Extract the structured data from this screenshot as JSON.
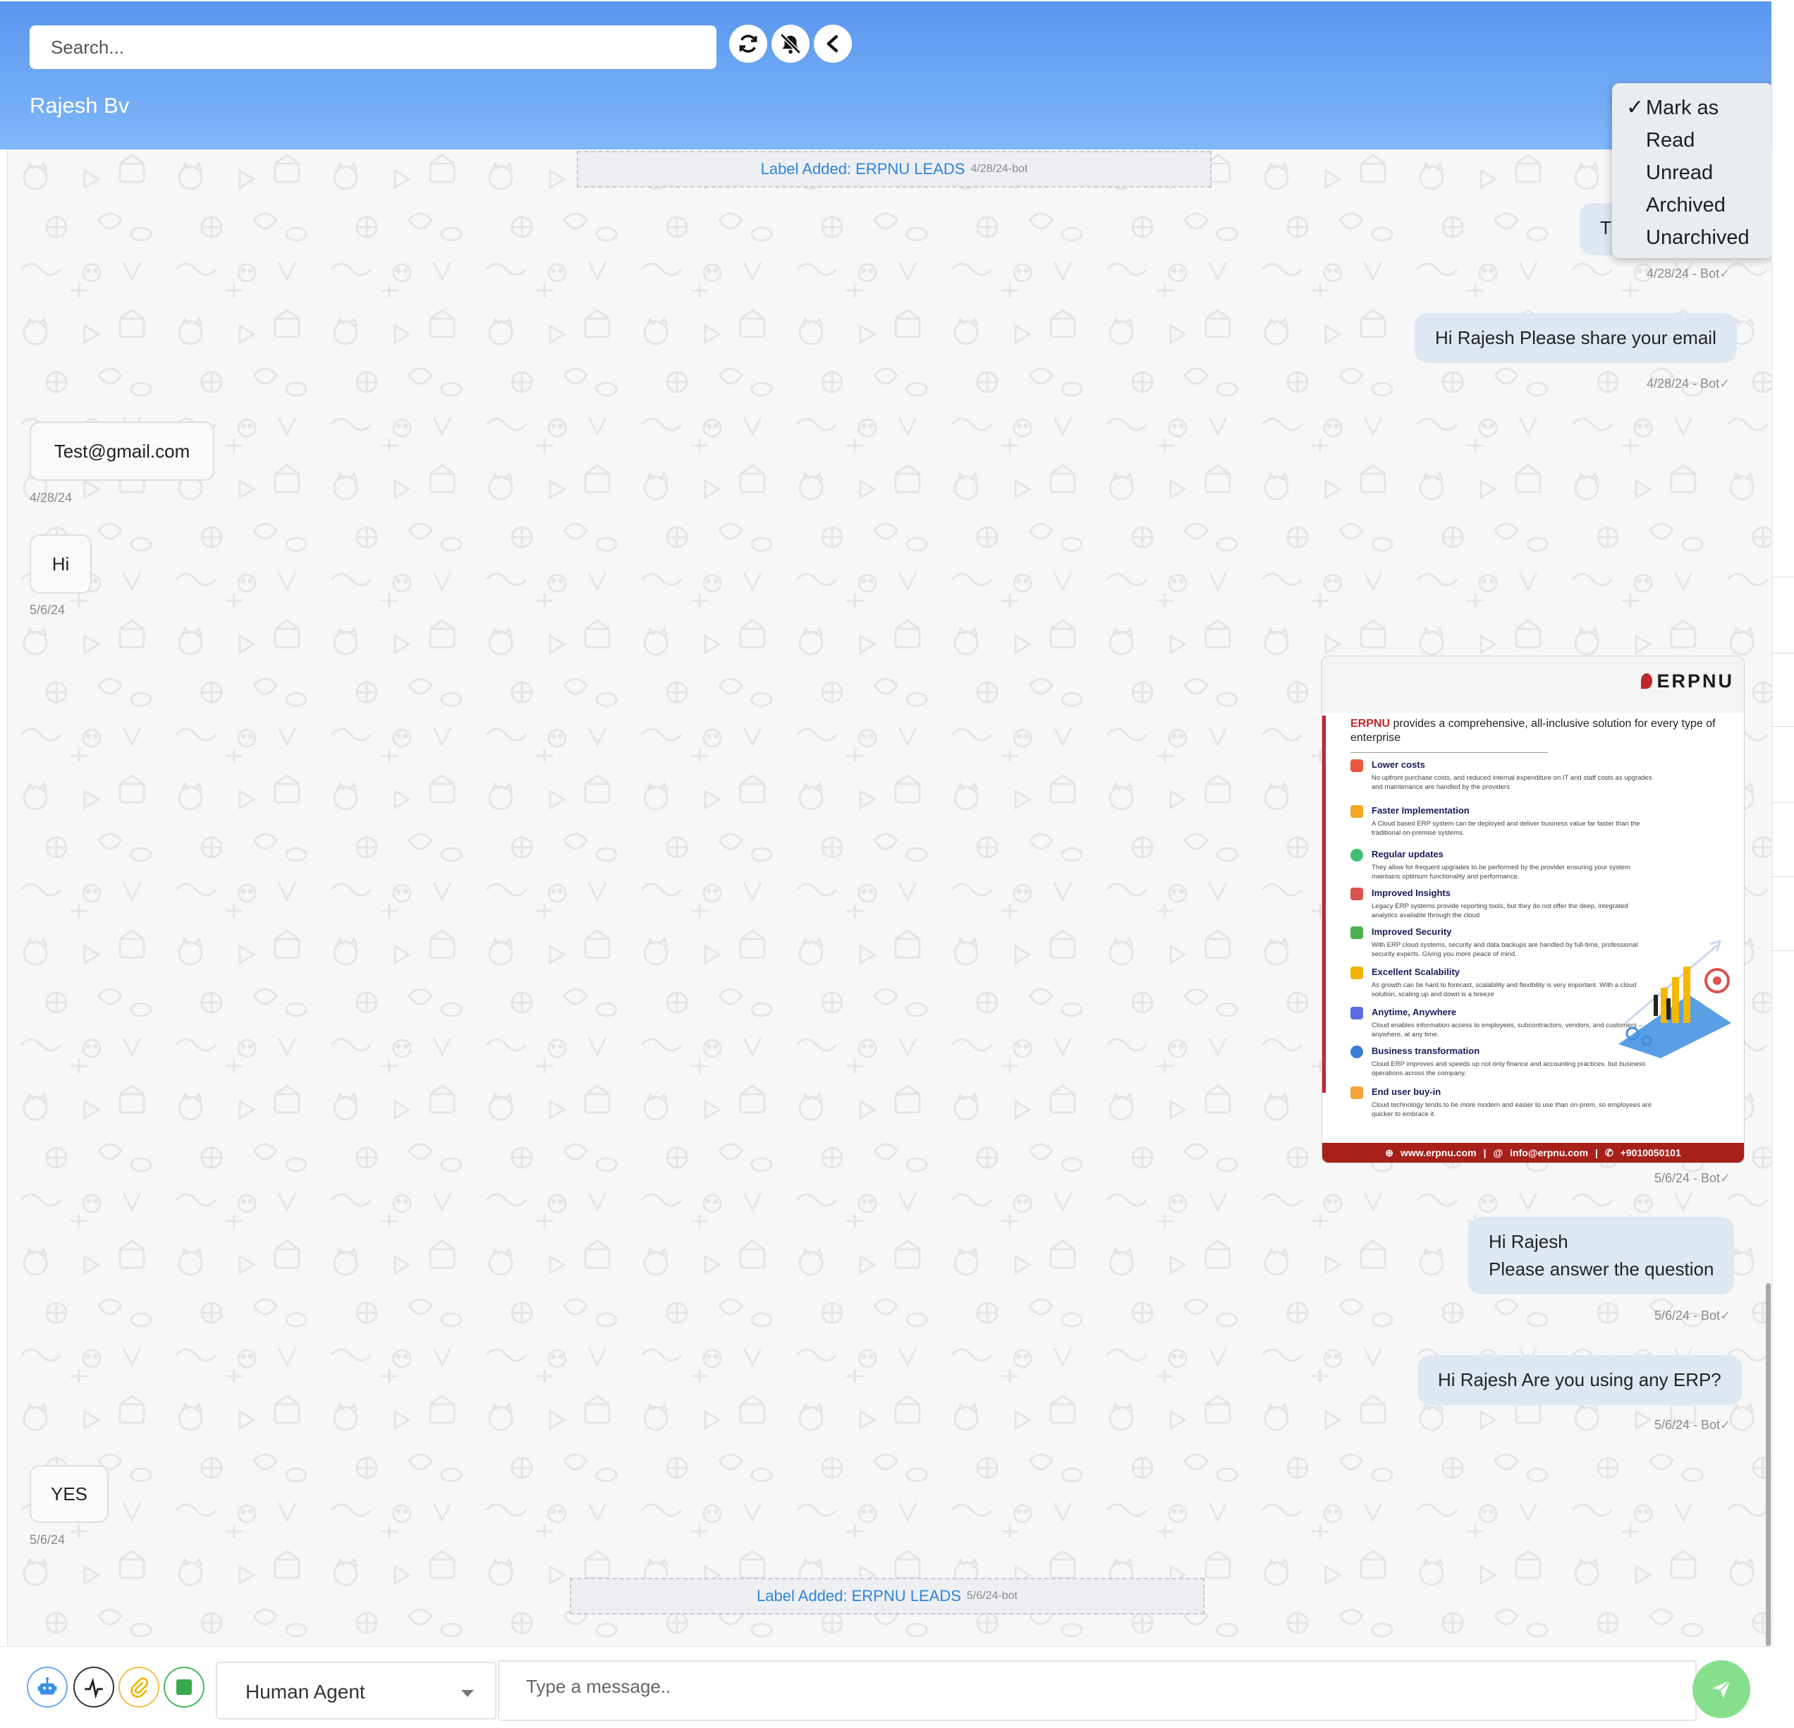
{
  "header": {
    "search_placeholder": "Search...",
    "contact_name": "Rajesh Bv",
    "buttons": [
      {
        "name": "refresh-icon"
      },
      {
        "name": "mute-notifications-icon"
      },
      {
        "name": "back-arrow-icon"
      }
    ]
  },
  "mark_as_menu": {
    "title": "Mark as",
    "items": [
      "Read",
      "Unread",
      "Archived",
      "Unarchived"
    ]
  },
  "messages": [
    {
      "type": "label",
      "text": "Label Added: ERPNU LEADS",
      "meta": "4/28/24-bot"
    },
    {
      "type": "outgoing",
      "text": "Th",
      "meta": "4/28/24 - Bot"
    },
    {
      "type": "outgoing",
      "text": "Hi Rajesh Please share your email",
      "meta": "4/28/24 - Bot"
    },
    {
      "type": "incoming",
      "text": "Test@gmail.com",
      "meta": "4/28/24"
    },
    {
      "type": "incoming",
      "text": "Hi",
      "meta": "5/6/24"
    },
    {
      "type": "outgoing-image",
      "meta": "5/6/24 - Bot"
    },
    {
      "type": "outgoing",
      "text_line1": "Hi Rajesh",
      "text_line2": "Please answer the question",
      "meta": "5/6/24 - Bot"
    },
    {
      "type": "outgoing",
      "text": "Hi Rajesh Are you using any ERP?",
      "meta": "5/6/24 - Bot"
    },
    {
      "type": "incoming",
      "text": "YES",
      "meta": "5/6/24"
    },
    {
      "type": "label",
      "text": "Label Added: ERPNU LEADS",
      "meta": "5/6/24-bot"
    }
  ],
  "flyer": {
    "logo": "ERPNU",
    "brand": "ERPNU",
    "intro": "provides a comprehensive, all-inclusive solution for every type of enterprise",
    "items": [
      {
        "title": "Lower costs",
        "desc": "No upfront purchase costs, and reduced internal expenditure on IT and staff costs as upgrades and maintenance are handled by the providers"
      },
      {
        "title": "Faster Implementation",
        "desc": "A Cloud based ERP system can be deployed and deliver business value far faster than the traditional on-premise systems."
      },
      {
        "title": "Regular updates",
        "desc": "They allow for frequent upgrades to be performed by the provider ensuring your system maintains optimum functionality and performance."
      },
      {
        "title": "Improved Insights",
        "desc": "Legacy ERP systems provide reporting tools, but they do not offer the deep, integrated analytics available through the cloud"
      },
      {
        "title": "Improved Security",
        "desc": "With ERP cloud systems, security and data backups are handled by full-time, professional security experts. Giving you more peace of mind."
      },
      {
        "title": "Excellent Scalability",
        "desc": "As growth can be hard to forecast, scalability and flexibility is very important. With a cloud solution, scaling up and down is a breeze"
      },
      {
        "title": "Anytime, Anywhere",
        "desc": "Cloud enables information access to employees, subcontractors, vendors, and customers – anywhere, at any time."
      },
      {
        "title": "Business transformation",
        "desc": "Cloud ERP improves and speeds up not only finance and accounting practices, but business operations across the company."
      },
      {
        "title": "End user buy-in",
        "desc": "Cloud technology tends to be more modern and easier to use than on-prem, so employees are quicker to embrace it."
      }
    ],
    "footer_web": "www.erpnu.com",
    "footer_email": "info@erpnu.com",
    "footer_phone": "+9010050101",
    "accent_color": "#c0272d"
  },
  "composer": {
    "buttons": [
      {
        "name": "bot-icon"
      },
      {
        "name": "signature-icon"
      },
      {
        "name": "attachment-icon"
      },
      {
        "name": "stop-icon"
      }
    ],
    "agent_select": "Human Agent",
    "message_placeholder": "Type a message..",
    "send": "send-icon"
  },
  "colors": {
    "header_top": "#5b96f0",
    "header_bottom": "#7fb7f8",
    "outgoing_bubble": "#dde8f2",
    "label_text": "#2f84d8",
    "send_button": "#86df8c"
  }
}
